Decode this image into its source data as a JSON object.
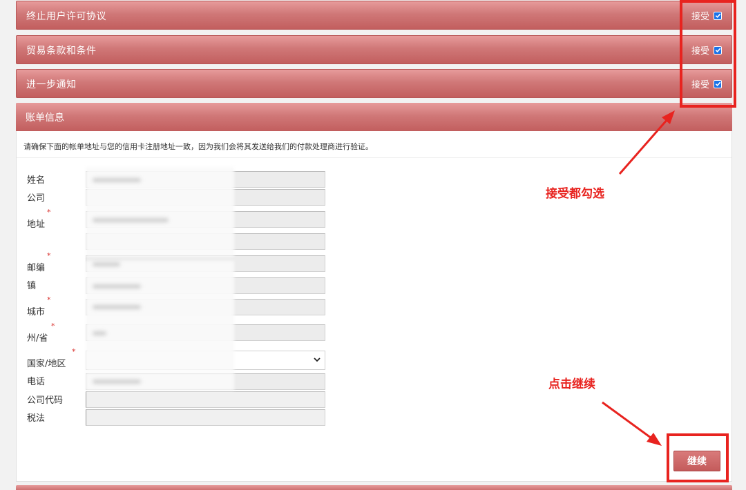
{
  "agreements": [
    {
      "title": "终止用户许可协议",
      "accept_label": "接受",
      "checked": true
    },
    {
      "title": "贸易条款和条件",
      "accept_label": "接受",
      "checked": true
    },
    {
      "title": "进一步通知",
      "accept_label": "接受",
      "checked": true
    }
  ],
  "billing": {
    "header": "账单信息",
    "note": "请确保下面的帐单地址与您的信用卡注册地址一致，因为我们会将其发送给我们的付款处理商进行验证。",
    "required_mark": "*",
    "fields": {
      "name": "姓名",
      "company": "公司",
      "address": "地址",
      "postcode": "邮编",
      "town": "镇",
      "city": "城市",
      "state": "州/省",
      "country": "国家/地区",
      "phone": "电话",
      "company_code": "公司代码",
      "tax": "税法"
    },
    "continue_label": "继续"
  },
  "annotations": {
    "accept_all": "接受都勾选",
    "click_continue": "点击继续",
    "color": "#e8231f"
  }
}
